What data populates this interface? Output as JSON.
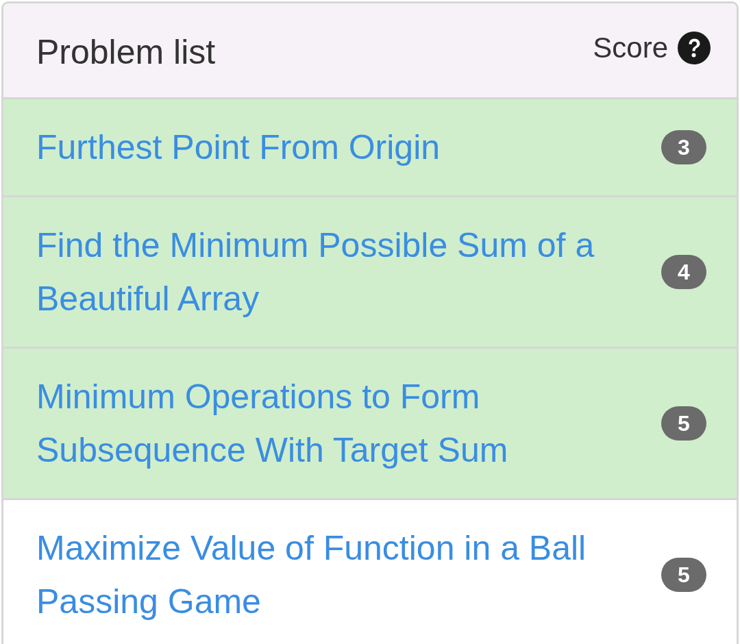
{
  "header": {
    "title": "Problem list",
    "score_label": "Score"
  },
  "problems": [
    {
      "title": "Furthest Point From Origin",
      "score": "3",
      "solved": true
    },
    {
      "title": "Find the Minimum Possible Sum of a Beautiful Array",
      "score": "4",
      "solved": true
    },
    {
      "title": "Minimum Operations to Form Subsequence With Target Sum",
      "score": "5",
      "solved": true
    },
    {
      "title": "Maximize Value of Function in a Ball Passing Game",
      "score": "5",
      "solved": false
    }
  ]
}
